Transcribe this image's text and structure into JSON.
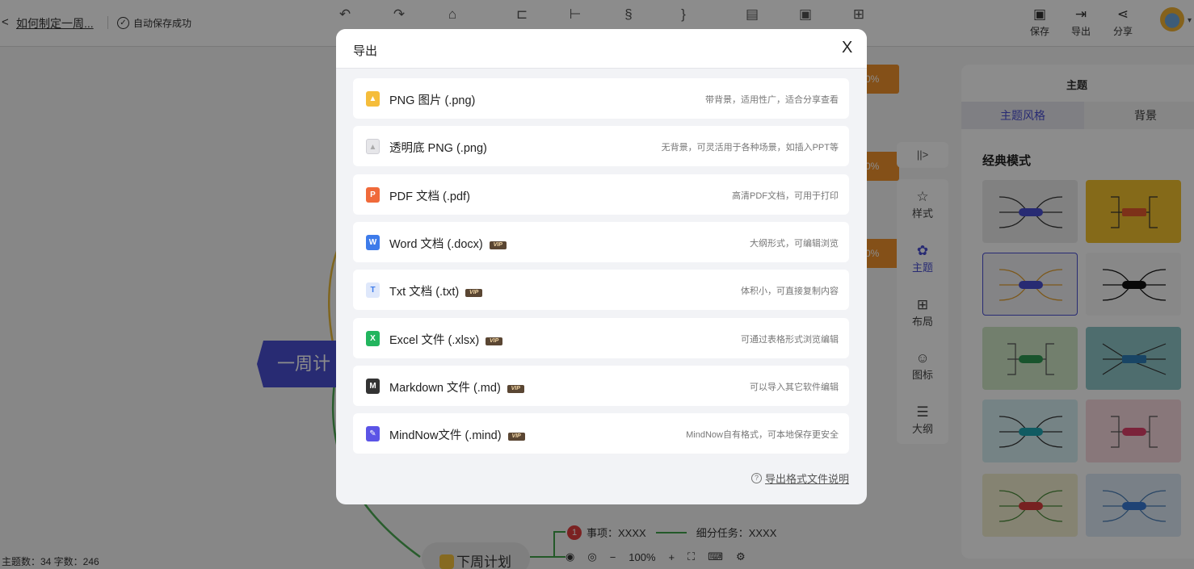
{
  "topbar": {
    "back_icon": "<",
    "doc_title": "如何制定一周...",
    "save_status": "自动保存成功",
    "right_tools": [
      {
        "icon": "save-icon",
        "label": "保存"
      },
      {
        "icon": "export-icon",
        "label": "导出"
      },
      {
        "icon": "share-icon",
        "label": "分享"
      }
    ]
  },
  "canvas": {
    "center_node": "一周计划",
    "orange_tags": [
      "0%",
      "0%",
      "0%"
    ],
    "next_week_node": "下周计划",
    "item_badge": "1",
    "item_text": "事项：XXXX",
    "subtask_text": "细分任务：XXXX",
    "stats": "主题数：34  字数：246",
    "zoom": "100%",
    "zoom_minus": "−",
    "zoom_plus": "+"
  },
  "side_tools": [
    {
      "icon": "style-icon",
      "label": "样式"
    },
    {
      "icon": "palette-icon",
      "label": "主题"
    },
    {
      "icon": "layout-icon",
      "label": "布局"
    },
    {
      "icon": "emoji-icon",
      "label": "图标"
    },
    {
      "icon": "outline-icon",
      "label": "大纲"
    }
  ],
  "theme_panel": {
    "title": "主题",
    "tabs": [
      "主题风格",
      "背景"
    ],
    "section": "经典模式"
  },
  "modal": {
    "title": "导出",
    "close": "X",
    "options": [
      {
        "label": "PNG 图片 (.png)",
        "desc": "带背景，适用性广，适合分享查看",
        "vip": false,
        "icon_color": "#f5bd3b",
        "icon": "image-icon"
      },
      {
        "label": "透明底 PNG (.png)",
        "desc": "无背景，可灵活用于各种场景，如插入PPT等",
        "vip": false,
        "icon_color": "#e6e6e9",
        "icon": "transparent-image-icon"
      },
      {
        "label": "PDF 文档 (.pdf)",
        "desc": "高清PDF文档，可用于打印",
        "vip": false,
        "icon_color": "#f06a3a",
        "icon": "pdf-icon",
        "icon_text": "P"
      },
      {
        "label": "Word 文档 (.docx)",
        "desc": "大纲形式，可编辑浏览",
        "vip": true,
        "icon_color": "#3d7bea",
        "icon": "word-icon",
        "icon_text": "W"
      },
      {
        "label": "Txt 文档 (.txt)",
        "desc": "体积小，可直接复制内容",
        "vip": true,
        "icon_color": "#dfe8fb",
        "icon": "txt-icon",
        "icon_text": "T"
      },
      {
        "label": "Excel 文件 (.xlsx)",
        "desc": "可通过表格形式浏览编辑",
        "vip": true,
        "icon_color": "#22b55e",
        "icon": "excel-icon",
        "icon_text": "X"
      },
      {
        "label": "Markdown 文件 (.md)",
        "desc": "可以导入其它软件编辑",
        "vip": true,
        "icon_color": "#333333",
        "icon": "markdown-icon",
        "icon_text": "M"
      },
      {
        "label": "MindNow文件 (.mind)",
        "desc": "MindNow自有格式，可本地保存更安全",
        "vip": true,
        "icon_color": "#5b54e6",
        "icon": "mindnow-icon",
        "icon_text": "✎"
      }
    ],
    "vip_badge": "VIP",
    "help_link": "导出格式文件说明"
  }
}
